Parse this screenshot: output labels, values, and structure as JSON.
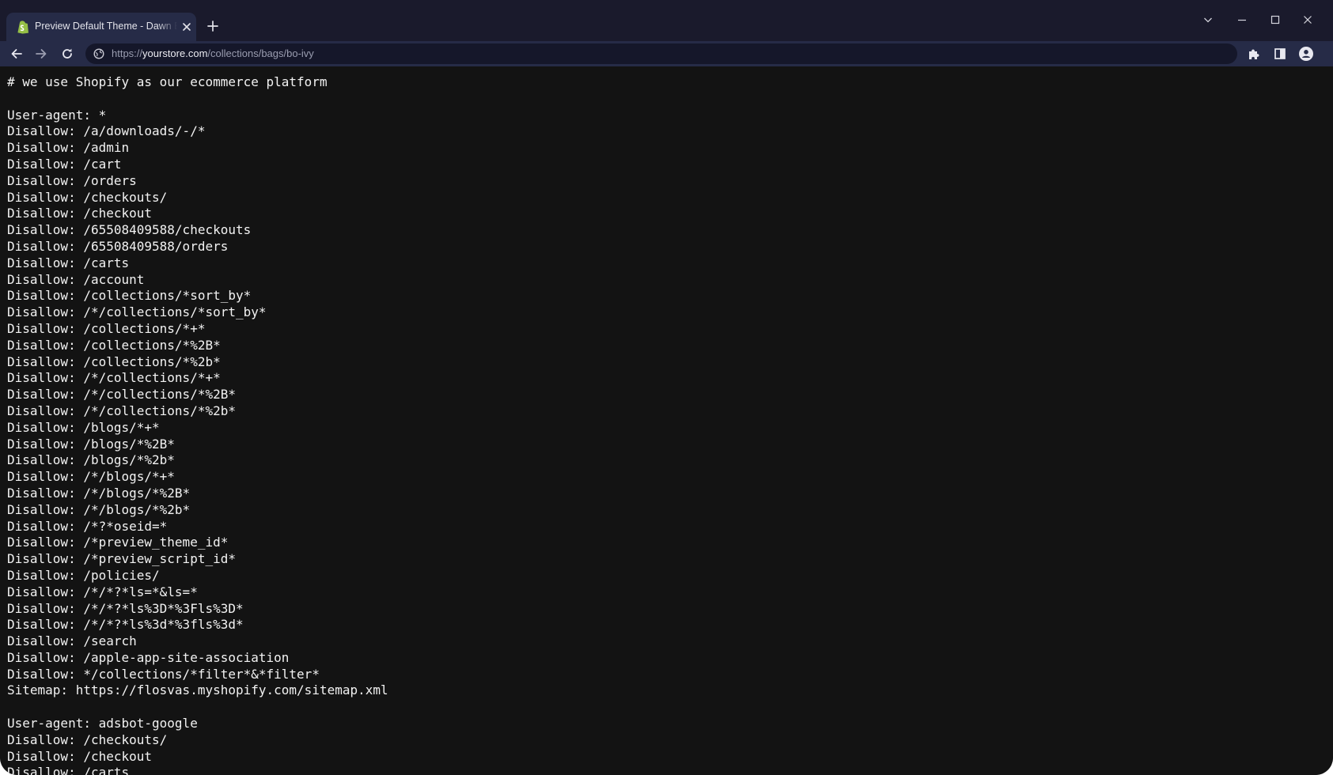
{
  "colors": {
    "tabstrip_bg": "#1a1a2c",
    "toolbar_bg": "#262b47",
    "omnibox_bg": "#15172a",
    "page_bg": "#131313",
    "text": "#f2f2f2",
    "shopify_green": "#95bf47"
  },
  "browser": {
    "tab": {
      "title": "Preview Default Theme - Dawn Edition",
      "favicon": "shopify-bag-icon",
      "close_icon": "close-icon"
    },
    "new_tab_icon": "plus-icon",
    "window_controls": [
      "chevron-down-icon",
      "minimize-icon",
      "maximize-icon",
      "close-icon"
    ],
    "nav": [
      "back-arrow-icon",
      "forward-arrow-icon",
      "reload-icon"
    ],
    "address": {
      "scheme": "https://",
      "host": "yourstore.com",
      "path": "/collections/bags/bo-ivy",
      "site_info_icon": "site-info-icon"
    },
    "toolbar_icons": [
      "puzzle-extension-icon",
      "side-panel-icon",
      "profile-icon"
    ]
  },
  "page": {
    "lines": [
      "# we use Shopify as our ecommerce platform",
      "",
      "User-agent: *",
      "Disallow: /a/downloads/-/*",
      "Disallow: /admin",
      "Disallow: /cart",
      "Disallow: /orders",
      "Disallow: /checkouts/",
      "Disallow: /checkout",
      "Disallow: /65508409588/checkouts",
      "Disallow: /65508409588/orders",
      "Disallow: /carts",
      "Disallow: /account",
      "Disallow: /collections/*sort_by*",
      "Disallow: /*/collections/*sort_by*",
      "Disallow: /collections/*+*",
      "Disallow: /collections/*%2B*",
      "Disallow: /collections/*%2b*",
      "Disallow: /*/collections/*+*",
      "Disallow: /*/collections/*%2B*",
      "Disallow: /*/collections/*%2b*",
      "Disallow: /blogs/*+*",
      "Disallow: /blogs/*%2B*",
      "Disallow: /blogs/*%2b*",
      "Disallow: /*/blogs/*+*",
      "Disallow: /*/blogs/*%2B*",
      "Disallow: /*/blogs/*%2b*",
      "Disallow: /*?*oseid=*",
      "Disallow: /*preview_theme_id*",
      "Disallow: /*preview_script_id*",
      "Disallow: /policies/",
      "Disallow: /*/*?*ls=*&ls=*",
      "Disallow: /*/*?*ls%3D*%3Fls%3D*",
      "Disallow: /*/*?*ls%3d*%3fls%3d*",
      "Disallow: /search",
      "Disallow: /apple-app-site-association",
      "Disallow: */collections/*filter*&*filter*",
      "Sitemap: https://flosvas.myshopify.com/sitemap.xml",
      "",
      "User-agent: adsbot-google",
      "Disallow: /checkouts/",
      "Disallow: /checkout",
      "Disallow: /carts"
    ]
  }
}
